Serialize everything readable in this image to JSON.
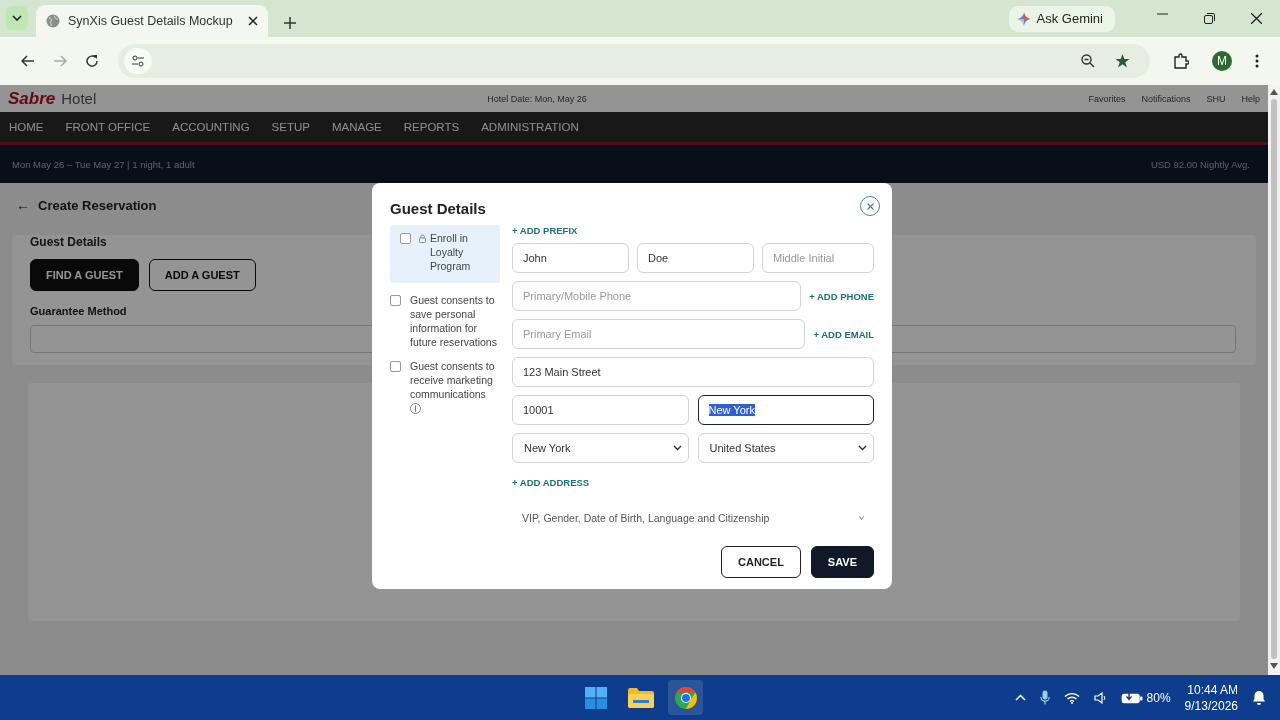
{
  "browser": {
    "tab_title": "SynXis Guest Details Mockup",
    "gemini_label": "Ask Gemini",
    "profile_initial": "M"
  },
  "app": {
    "brand": "Sabre",
    "brand_suffix": "Hotel",
    "hotel_date": "Hotel Date: Mon, May 26",
    "header_links": [
      "Favorites",
      "Notifications",
      "SHU",
      "Help"
    ],
    "nav": [
      "HOME",
      "FRONT OFFICE",
      "ACCOUNTING",
      "SETUP",
      "MANAGE",
      "REPORTS",
      "ADMINISTRATION"
    ],
    "stay_summary": "Mon May 26 – Tue May 27 | 1 night, 1 adult",
    "rate": "USD 92.00 Nightly Avg.",
    "back_glyph": "←",
    "page_title": "Create Reservation",
    "section_title": "Guest Details",
    "guest_buttons": [
      {
        "label": "FIND A GUEST",
        "selected": true
      },
      {
        "label": "ADD A GUEST",
        "selected": false
      }
    ],
    "guarantee_label": "Guarantee Method"
  },
  "modal": {
    "title": "Guest Details",
    "options": [
      {
        "kind": "loyalty",
        "label": "Enroll in Loyalty Program",
        "checked": false
      },
      {
        "kind": "consent",
        "label": "Guest consents to save personal information for future reservations",
        "checked": false
      },
      {
        "kind": "consent_info",
        "label": "Guest consents to receive marketing communications",
        "checked": false
      }
    ],
    "add_prefix": "+ ADD PREFIX",
    "name_fields": [
      {
        "value": "John"
      },
      {
        "value": "Doe"
      },
      {
        "placeholder": "Middle Initial"
      }
    ],
    "phone": {
      "placeholder": "Primary/Mobile Phone",
      "add": "+ ADD PHONE"
    },
    "email": {
      "placeholder": "Primary Email",
      "add": "+ ADD EMAIL"
    },
    "street": {
      "value": "123 Main Street"
    },
    "postal": {
      "value": "10001"
    },
    "city": {
      "value": "New York",
      "focused": true
    },
    "state": "New York",
    "country": "United States",
    "add_address": "+ ADD ADDRESS",
    "more": {
      "label": "VIP, Gender, Date of Birth, Language and Citizenship",
      "expanded": false
    },
    "actions": [
      {
        "kind": "secondary",
        "label": "CANCEL"
      },
      {
        "kind": "primary",
        "label": "SAVE"
      }
    ]
  },
  "taskbar": {
    "battery": "80%",
    "time": "10:44 AM",
    "date": "9/13/2026"
  }
}
